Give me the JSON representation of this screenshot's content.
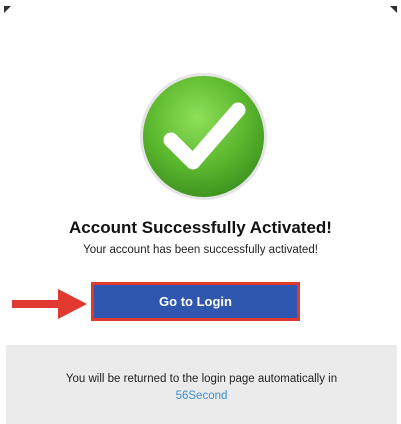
{
  "success": {
    "icon": "checkmark-icon",
    "title": "Account Successfully Activated!",
    "message": "Your account has been successfully activated!"
  },
  "login_button": {
    "label": "Go to Login"
  },
  "redirect": {
    "message": "You will be returned to the login page automatically in",
    "countdown_text": "56Second"
  },
  "colors": {
    "success_green": "#5cb82e",
    "button_blue": "#2f57b0",
    "highlight_red": "#e0392f",
    "link_blue": "#3a8fd6",
    "footer_bg": "#ebebeb"
  }
}
